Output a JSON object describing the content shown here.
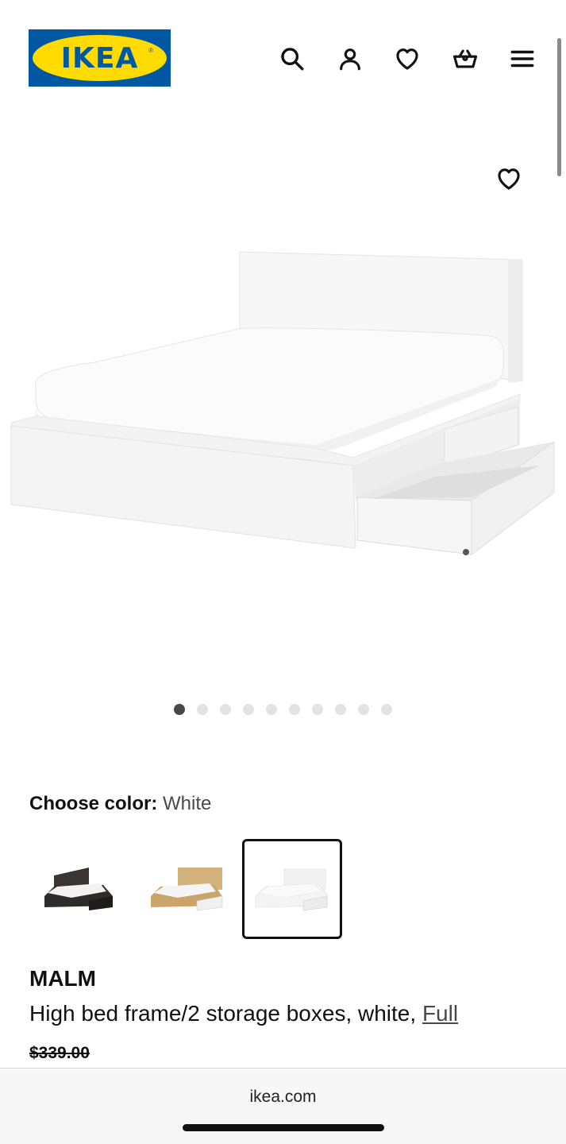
{
  "header": {
    "logo_text": "IKEA",
    "logo_colors": {
      "blue": "#0058a3",
      "yellow": "#ffdb00"
    },
    "icons": [
      "search-icon",
      "account-icon",
      "heart-icon",
      "basket-icon",
      "menu-icon"
    ]
  },
  "gallery": {
    "favorite_icon": "heart-icon",
    "image_count": 10,
    "active_index": 0
  },
  "color_picker": {
    "label": "Choose color:",
    "selected_value": "White",
    "options": [
      {
        "name": "black-brown",
        "swatch": "#2e2b28"
      },
      {
        "name": "oak veneer",
        "swatch": "#c9a56c"
      },
      {
        "name": "white",
        "swatch": "#f4f4f4"
      }
    ],
    "selected_index": 2
  },
  "product": {
    "name": "MALM",
    "description": "High bed frame/2 storage boxes, white, ",
    "size_link": "Full",
    "old_price": "$339.00"
  },
  "browser": {
    "url": "ikea.com"
  }
}
